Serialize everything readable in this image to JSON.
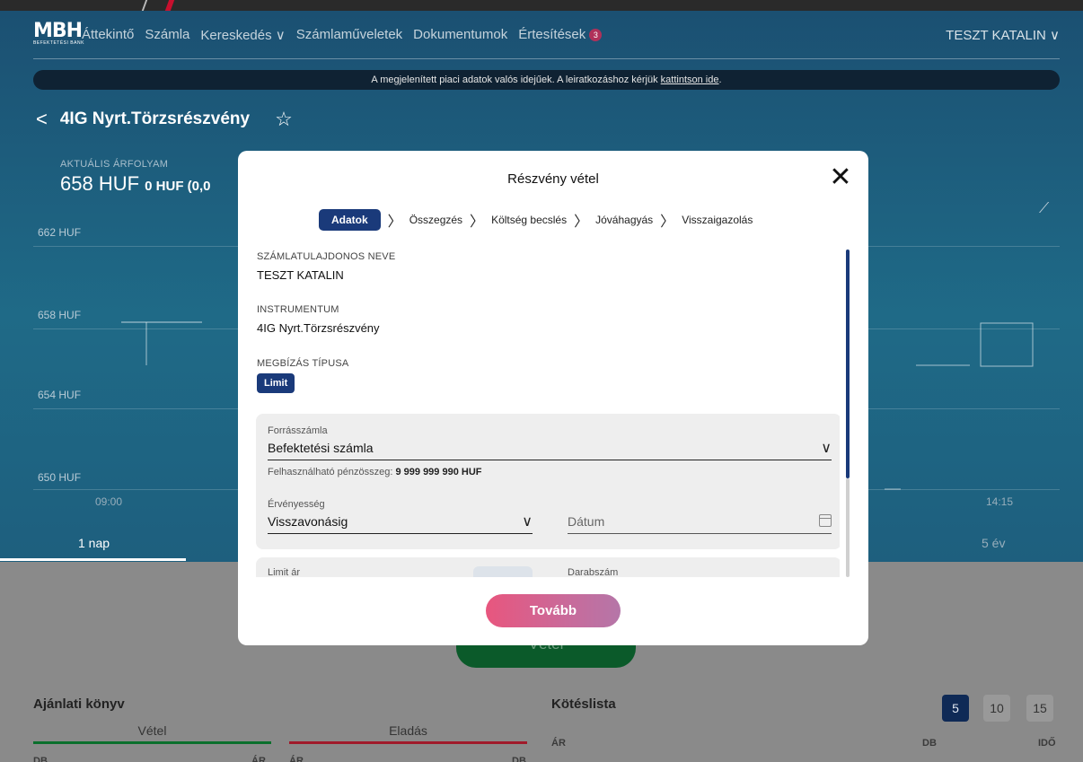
{
  "header": {
    "logo_mark": "MBH",
    "logo_sub": "BEFEKTETÉSI BANK",
    "nav": [
      "Áttekintő",
      "Számla",
      "Kereskedés",
      "Számlaműveletek",
      "Dokumentumok",
      "Értesítések"
    ],
    "notifications_count": "3",
    "user": "TESZT KATALIN"
  },
  "notice": {
    "text": "A megjelenített piaci adatok valós idejűek. A leiratkozáshoz kérjük ",
    "link": "kattintson ide",
    "end": "."
  },
  "stock": {
    "title": "4IG Nyrt.Törzsrészvény",
    "price_label": "AKTUÁLIS ÁRFOLYAM",
    "price": "658 HUF",
    "change": "0 HUF (0,0"
  },
  "chart_axis": {
    "y_labels": [
      "662 HUF",
      "658 HUF",
      "654 HUF",
      "650 HUF"
    ],
    "x_labels": [
      "09:00",
      "14:15"
    ]
  },
  "periods": [
    "1 nap",
    "5 év"
  ],
  "lower": {
    "buy_button": "Vétel",
    "order_book_title": "Ajánlati könyv",
    "tab_buy": "Vétel",
    "tab_sell": "Eladás",
    "trades_title": "Kötéslista",
    "col_ar": "ÁR",
    "col_db": "DB",
    "col_ido": "IDŐ",
    "ob_col_db": "DB",
    "ob_col_ar": "ÁR",
    "ob_col_ar2": "ÁR",
    "ob_col_db2": "DB",
    "counts": [
      "5",
      "10",
      "15"
    ]
  },
  "modal": {
    "title": "Részvény vétel",
    "close": "✕",
    "steps": [
      "Adatok",
      "Összegzés",
      "Költség becslés",
      "Jóváhagyás",
      "Visszaigazolás"
    ],
    "owner_label": "SZÁMLATULAJDONOS NEVE",
    "owner_value": "TESZT KATALIN",
    "instrument_label": "INSTRUMENTUM",
    "instrument_value": "4IG Nyrt.Törzsrészvény",
    "order_type_label": "MEGBÍZÁS TÍPUSA",
    "order_type_value": "Limit",
    "source_label": "Forrásszámla",
    "source_value": "Befektetési számla",
    "available_label": "Felhasználható pénzösszeg: ",
    "available_value": "9 999 999 990 HUF",
    "validity_label": "Érvényesség",
    "validity_value": "Visszavonásig",
    "date_placeholder": "Dátum",
    "limit_price_label": "Limit ár",
    "quantity_label": "Darabszám",
    "next_button": "Tovább"
  },
  "colors": {
    "accent": "#1a3a7a",
    "next_gradient_start": "#e8567e",
    "next_gradient_end": "#b576a8"
  }
}
